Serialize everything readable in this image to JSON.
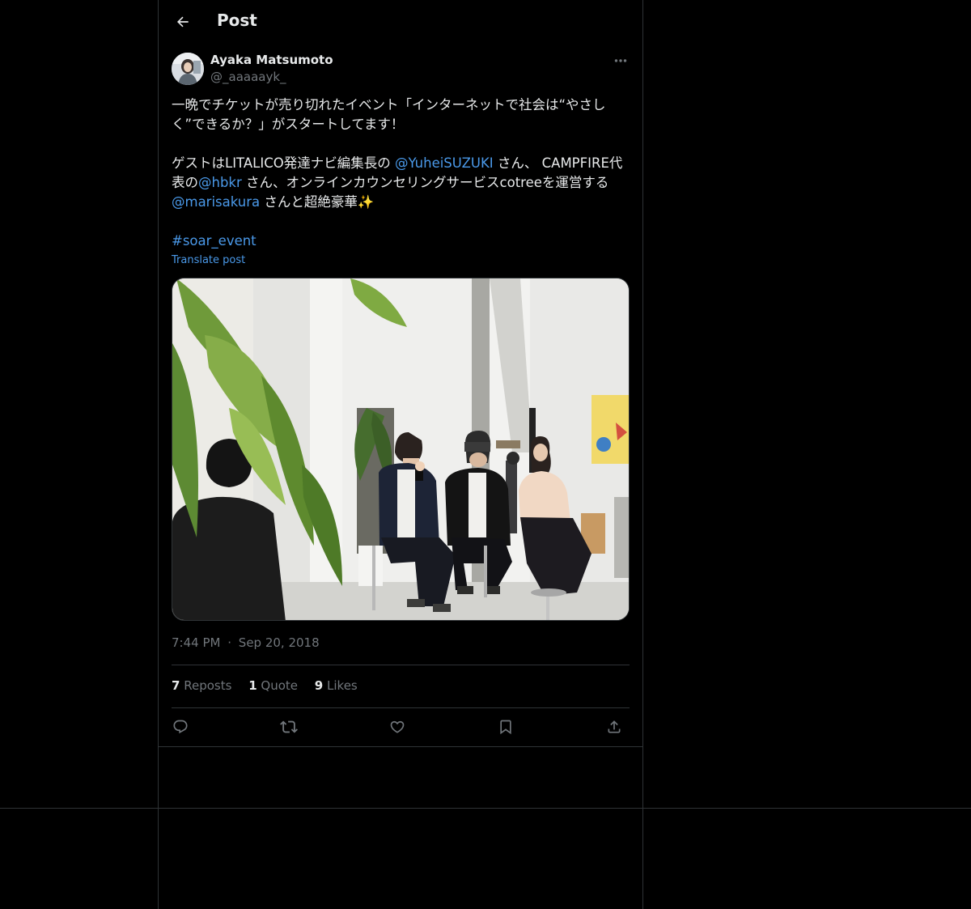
{
  "header": {
    "title": "Post"
  },
  "author": {
    "display_name": "Ayaka Matsumoto",
    "handle": "@_aaaaayk_"
  },
  "tweet": {
    "line1": "一晩でチケットが売り切れたイベント「インターネットで社会は“やさし",
    "line2": "く”できるか？」がスタートしてます！",
    "line3_pre": "ゲストはLITALICO発達ナビ編集長の ",
    "mention1": "@YuheiSUZUKI",
    "line3_post": " さん、 CAMPFIRE代",
    "line4_pre": "表の",
    "mention2": "@hbkr",
    "line4_post": " さん、オンラインカウンセリングサービスcotreeを運営する",
    "mention3": "@marisakura",
    "line5_post": " さんと超絶豪華✨",
    "hashtag": "#soar_event",
    "translate": "Translate post"
  },
  "meta": {
    "time": "7:44 PM",
    "separator": "·",
    "date": "Sep 20, 2018"
  },
  "stats": {
    "reposts_count": "7",
    "reposts_label": "Reposts",
    "quotes_count": "1",
    "quotes_label": "Quote",
    "likes_count": "9",
    "likes_label": "Likes"
  },
  "colors": {
    "link": "#4a99e9",
    "muted": "#71767b",
    "border": "#2f3336",
    "text": "#e7e9ea"
  },
  "icons": [
    "back-arrow-icon",
    "more-icon",
    "reply-icon",
    "repost-icon",
    "like-icon",
    "bookmark-icon",
    "share-icon"
  ]
}
